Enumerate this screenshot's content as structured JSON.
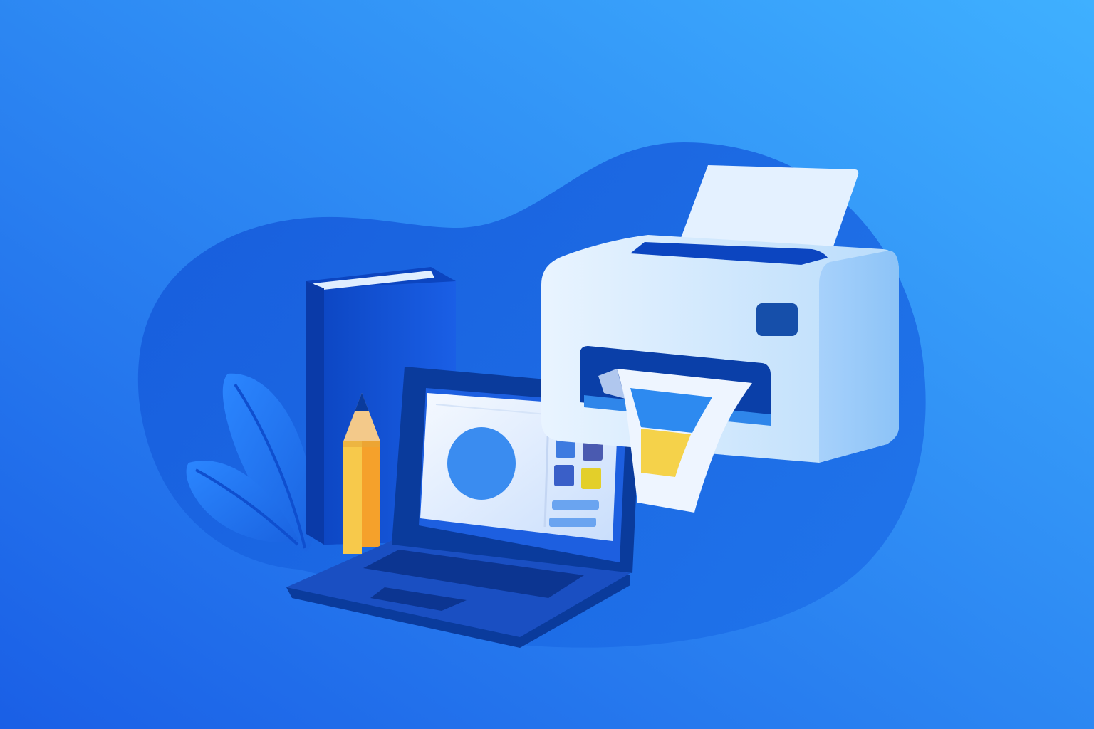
{
  "scene": {
    "kind": "flat-vector-illustration",
    "objects": [
      "leaf-plant",
      "book",
      "pencil",
      "laptop",
      "printer",
      "printed-paper"
    ]
  },
  "icons": {
    "plant": "leaf-icon",
    "book": "book-icon",
    "pencil": "pencil-icon",
    "laptop": "laptop-icon",
    "printer": "printer-icon",
    "paper": "document-icon"
  },
  "colors": {
    "background_start": "#1a5fe6",
    "background_end": "#3fb0ff",
    "blob": "#1a63e0",
    "accent_yellow": "#f5d24a",
    "pencil_body": "#f7b731",
    "laptop_dark": "#0a3b9c",
    "printer_body": "#d6ecff",
    "screen_circle": "#3a8cf0"
  }
}
